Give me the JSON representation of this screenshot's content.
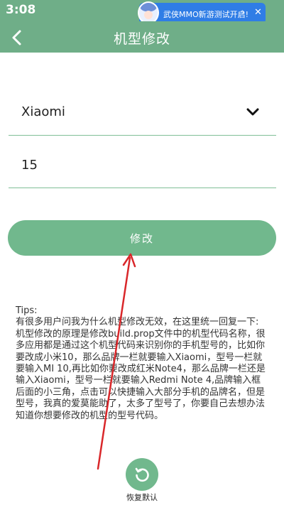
{
  "status_bar": {
    "time": "3:08",
    "notification": {
      "text": "武侠MMO新游测试开启!",
      "arrow_icon": "chevron-right-icon",
      "close_icon": "close-icon"
    }
  },
  "app_bar": {
    "title": "机型修改",
    "back_icon": "back-arrow-icon"
  },
  "form": {
    "brand_value": "Xiaomi",
    "model_value": "15",
    "submit_label": "修改"
  },
  "tips": {
    "lines": [
      "Tips:",
      "有很多用户问我为什么机型修改无效，在这里统一回复一下:",
      "机型修改的原理是修改build.prop文件中的机型代码名称，很多应用都是通过这个机型代码来识别你的手机型号的，比如你要改成小米10，那么品牌一栏就要输入Xiaomi，型号一栏就要输入MI 10,再比如你要改成红米Note4，那么品牌一栏还是输入Xiaomi，型号一栏就要输入Redmi Note 4,品牌输入框后面的小三角，点击可以快捷输入大部分手机的品牌名，但是型号，我真的爱莫能助了，太多了型号了，你要自己去想办法知道你想要修改的机型的型号代码。"
    ]
  },
  "restore": {
    "label": "恢复默认",
    "icon": "restore-icon"
  },
  "colors": {
    "primary": "#6fae88",
    "button": "#71b88d",
    "notification": "#2f7de6",
    "annotation": "#d9272a"
  }
}
